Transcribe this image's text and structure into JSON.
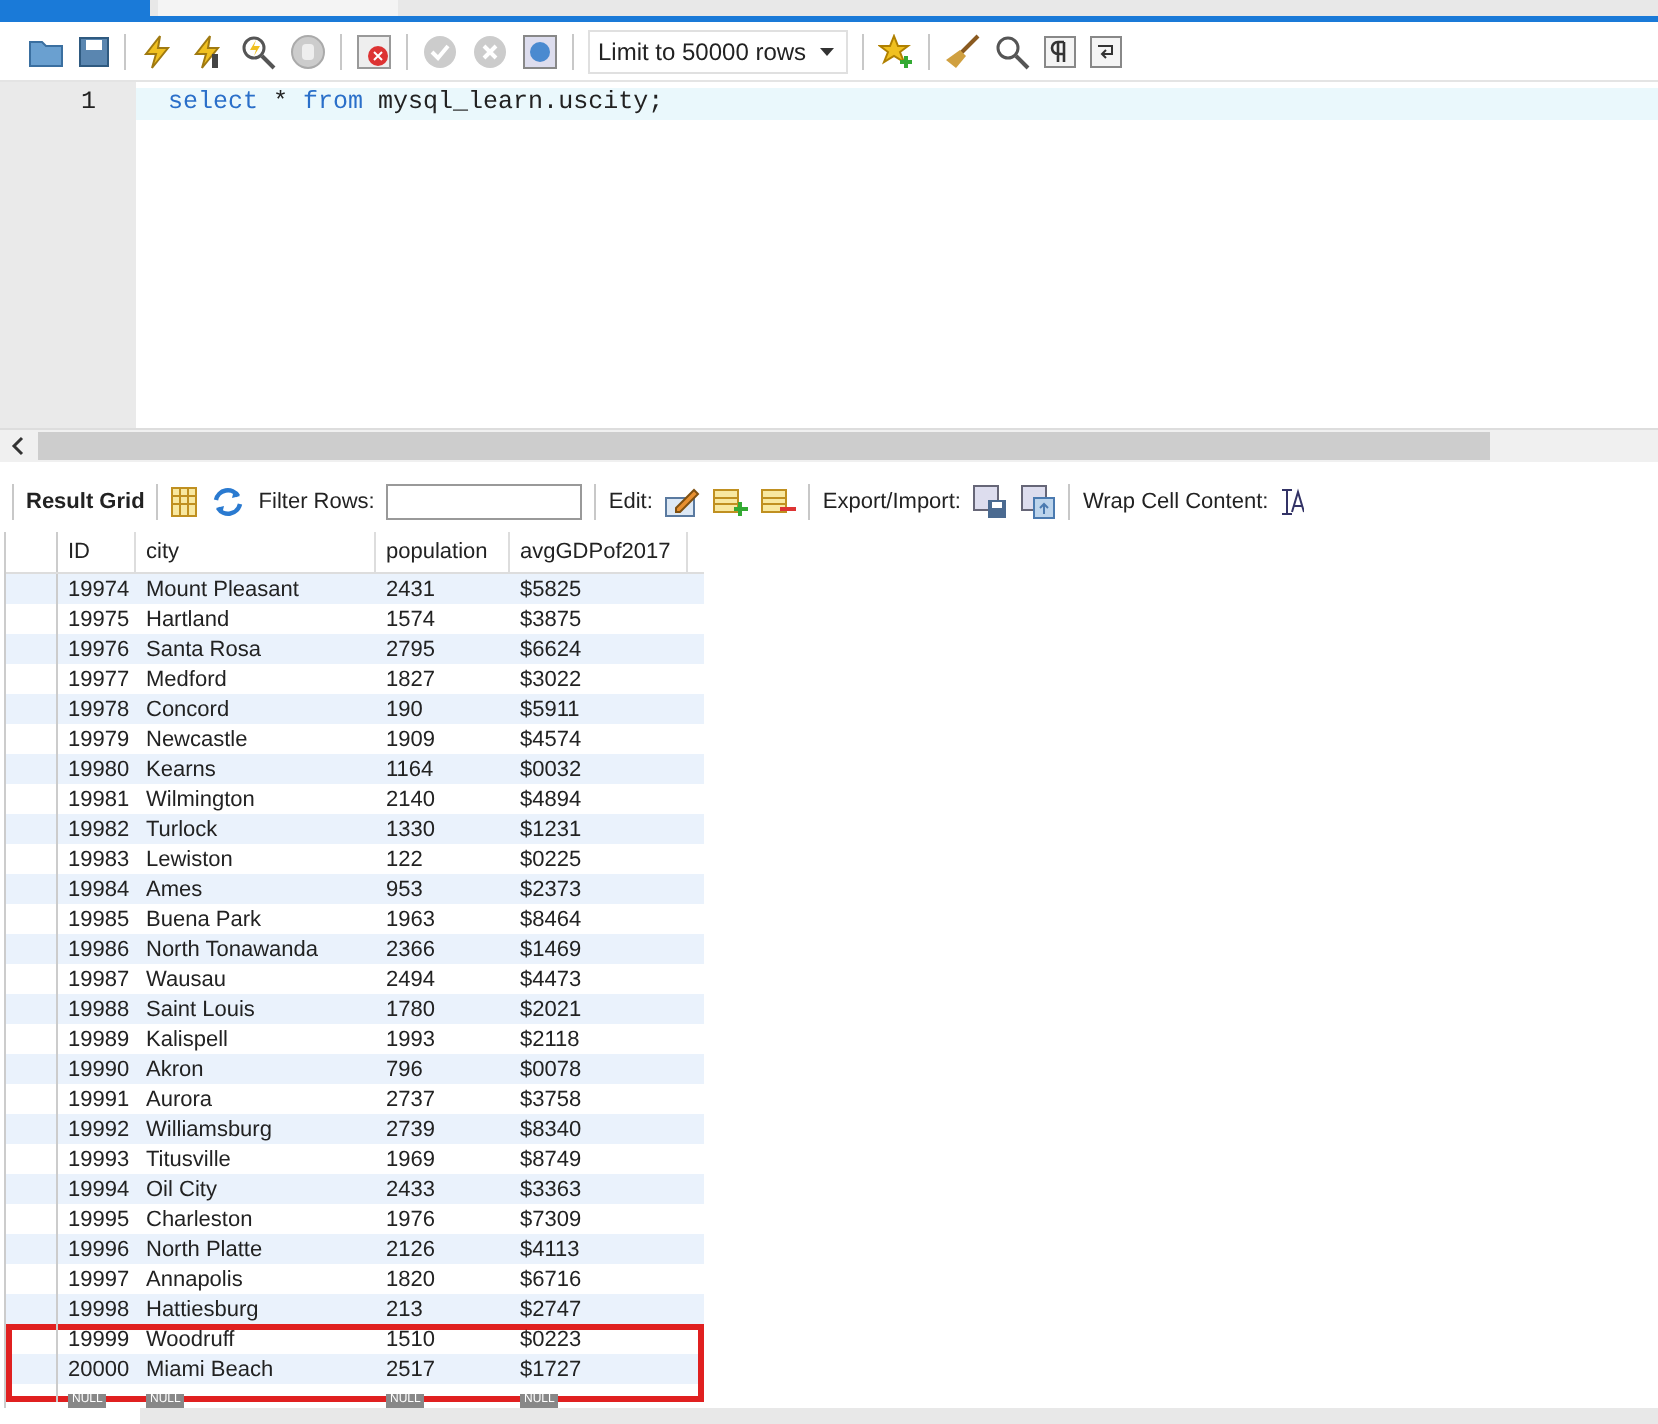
{
  "editor": {
    "lines": [
      {
        "number": "1",
        "tokens": [
          {
            "kind": "keyword",
            "text": "select"
          },
          {
            "kind": "plain",
            "text": " * "
          },
          {
            "kind": "keyword",
            "text": "from"
          },
          {
            "kind": "plain",
            "text": " mysql_learn.uscity;"
          }
        ]
      }
    ]
  },
  "toolbar": {
    "limit": "Limit to 50000 rows"
  },
  "result_toolbar": {
    "title": "Result Grid",
    "filter_label": "Filter Rows:",
    "edit_label": "Edit:",
    "export_label": "Export/Import:",
    "wrap_label": "Wrap Cell Content:"
  },
  "table": {
    "columns": [
      "ID",
      "city",
      "population",
      "avgGDPof2017"
    ],
    "rows": [
      {
        "cells": [
          "19974",
          "Mount Pleasant",
          "2431",
          "$5825"
        ],
        "highlighted": false
      },
      {
        "cells": [
          "19975",
          "Hartland",
          "1574",
          "$3875"
        ],
        "highlighted": false
      },
      {
        "cells": [
          "19976",
          "Santa Rosa",
          "2795",
          "$6624"
        ],
        "highlighted": false
      },
      {
        "cells": [
          "19977",
          "Medford",
          "1827",
          "$3022"
        ],
        "highlighted": false
      },
      {
        "cells": [
          "19978",
          "Concord",
          "190",
          "$5911"
        ],
        "highlighted": false
      },
      {
        "cells": [
          "19979",
          "Newcastle",
          "1909",
          "$4574"
        ],
        "highlighted": false
      },
      {
        "cells": [
          "19980",
          "Kearns",
          "1164",
          "$0032"
        ],
        "highlighted": false
      },
      {
        "cells": [
          "19981",
          "Wilmington",
          "2140",
          "$4894"
        ],
        "highlighted": false
      },
      {
        "cells": [
          "19982",
          "Turlock",
          "1330",
          "$1231"
        ],
        "highlighted": false
      },
      {
        "cells": [
          "19983",
          "Lewiston",
          "122",
          "$0225"
        ],
        "highlighted": false
      },
      {
        "cells": [
          "19984",
          "Ames",
          "953",
          "$2373"
        ],
        "highlighted": false
      },
      {
        "cells": [
          "19985",
          "Buena Park",
          "1963",
          "$8464"
        ],
        "highlighted": false
      },
      {
        "cells": [
          "19986",
          "North Tonawanda",
          "2366",
          "$1469"
        ],
        "highlighted": false
      },
      {
        "cells": [
          "19987",
          "Wausau",
          "2494",
          "$4473"
        ],
        "highlighted": false
      },
      {
        "cells": [
          "19988",
          "Saint Louis",
          "1780",
          "$2021"
        ],
        "highlighted": false
      },
      {
        "cells": [
          "19989",
          "Kalispell",
          "1993",
          "$2118"
        ],
        "highlighted": false
      },
      {
        "cells": [
          "19990",
          "Akron",
          "796",
          "$0078"
        ],
        "highlighted": false
      },
      {
        "cells": [
          "19991",
          "Aurora",
          "2737",
          "$3758"
        ],
        "highlighted": false
      },
      {
        "cells": [
          "19992",
          "Williamsburg",
          "2739",
          "$8340"
        ],
        "highlighted": false
      },
      {
        "cells": [
          "19993",
          "Titusville",
          "1969",
          "$8749"
        ],
        "highlighted": false
      },
      {
        "cells": [
          "19994",
          "Oil City",
          "2433",
          "$3363"
        ],
        "highlighted": false
      },
      {
        "cells": [
          "19995",
          "Charleston",
          "1976",
          "$7309"
        ],
        "highlighted": false
      },
      {
        "cells": [
          "19996",
          "North Platte",
          "2126",
          "$4113"
        ],
        "highlighted": false
      },
      {
        "cells": [
          "19997",
          "Annapolis",
          "1820",
          "$6716"
        ],
        "highlighted": false
      },
      {
        "cells": [
          "19998",
          "Hattiesburg",
          "213",
          "$2747"
        ],
        "highlighted": false
      },
      {
        "cells": [
          "19999",
          "Woodruff",
          "1510",
          "$0223"
        ],
        "highlighted": true
      },
      {
        "cells": [
          "20000",
          "Miami Beach",
          "2517",
          "$1727"
        ],
        "highlighted": true
      }
    ],
    "new_row": [
      "NULL",
      "NULL",
      "NULL",
      "NULL"
    ]
  }
}
